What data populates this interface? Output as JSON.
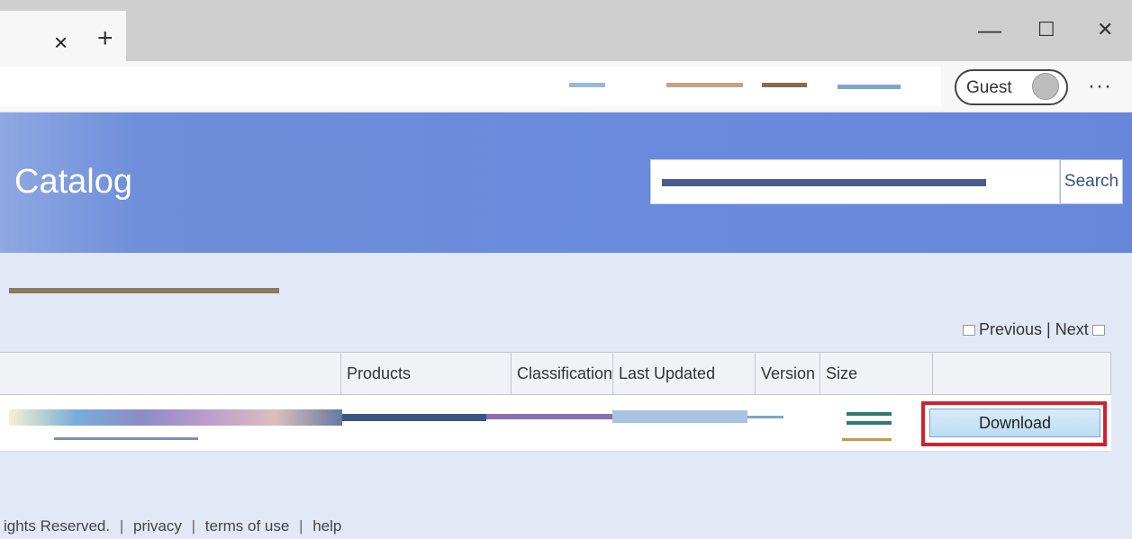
{
  "browser": {
    "tab_close": "×",
    "new_tab": "+",
    "minimize": "—",
    "maximize": "☐",
    "close": "✕",
    "profile_label": "Guest",
    "more_label": "···"
  },
  "page": {
    "title": "Catalog",
    "search_button": "Search"
  },
  "pager": {
    "previous": "Previous",
    "separator": "|",
    "next": "Next"
  },
  "table": {
    "columns": [
      "",
      "Products",
      "Classification",
      "Last Updated",
      "Version",
      "Size",
      ""
    ],
    "download_label": "Download"
  },
  "footer": {
    "rights": "ights Reserved.",
    "sep": "|",
    "privacy": "privacy",
    "terms": "terms of use",
    "help": "help"
  },
  "colors": {
    "banner": "#6787db",
    "highlight": "#d3202d",
    "button": "#bcdcf4"
  }
}
